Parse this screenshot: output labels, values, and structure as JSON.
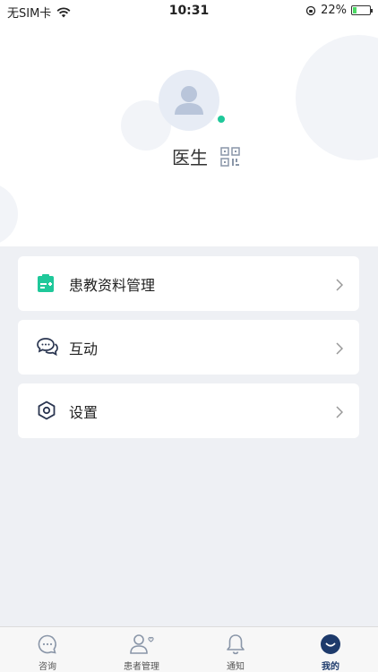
{
  "status_bar": {
    "carrier": "无SIM卡",
    "time": "10:31",
    "battery": "22%",
    "battery_level": 0.22
  },
  "profile": {
    "name": "医生"
  },
  "menu": [
    {
      "label": "患教资料管理",
      "icon": "document-plus-icon"
    },
    {
      "label": "互动",
      "icon": "chat-bubbles-icon"
    },
    {
      "label": "设置",
      "icon": "hexagon-gear-icon"
    }
  ],
  "tabs": [
    {
      "label": "咨询",
      "icon": "chat-icon",
      "active": false
    },
    {
      "label": "患者管理",
      "icon": "patients-icon",
      "active": false
    },
    {
      "label": "通知",
      "icon": "bell-icon",
      "active": false
    },
    {
      "label": "我的",
      "icon": "smile-icon",
      "active": true
    }
  ],
  "colors": {
    "accent_green": "#1fc89a",
    "nav_active": "#1d3a6b"
  }
}
